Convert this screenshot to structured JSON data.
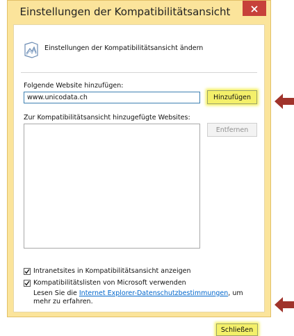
{
  "window": {
    "title": "Einstellungen der Kompatibilitätsansicht",
    "close_glyph": "×"
  },
  "header": {
    "text": "Einstellungen der Kompatibilitätsansicht ändern",
    "icon": "compatibility-view-icon"
  },
  "add_site": {
    "label": "Folgende Website hinzufügen:",
    "value": "www.unicodata.ch",
    "button_label": "Hinzufügen"
  },
  "sites_list": {
    "label": "Zur Kompatibilitätsansicht hinzugefügte Websites:",
    "items": [],
    "remove_label": "Entfernen"
  },
  "options": {
    "intranet": {
      "label": "Intranetsites in Kompatibilitätsansicht anzeigen",
      "checked": true
    },
    "microsoft_lists": {
      "label": "Kompatibilitätslisten von Microsoft verwenden",
      "checked": true
    }
  },
  "info": {
    "prefix": "Lesen Sie die ",
    "link": "Internet Explorer-Datenschutzbestimmungen",
    "suffix": ", um mehr zu erfahren."
  },
  "footer": {
    "close_label": "Schließen"
  },
  "colors": {
    "frame": "#fbe49b",
    "close_button": "#c7413a",
    "highlight": "#f4f06a",
    "arrow": "#a0332b",
    "link": "#0066cc"
  }
}
